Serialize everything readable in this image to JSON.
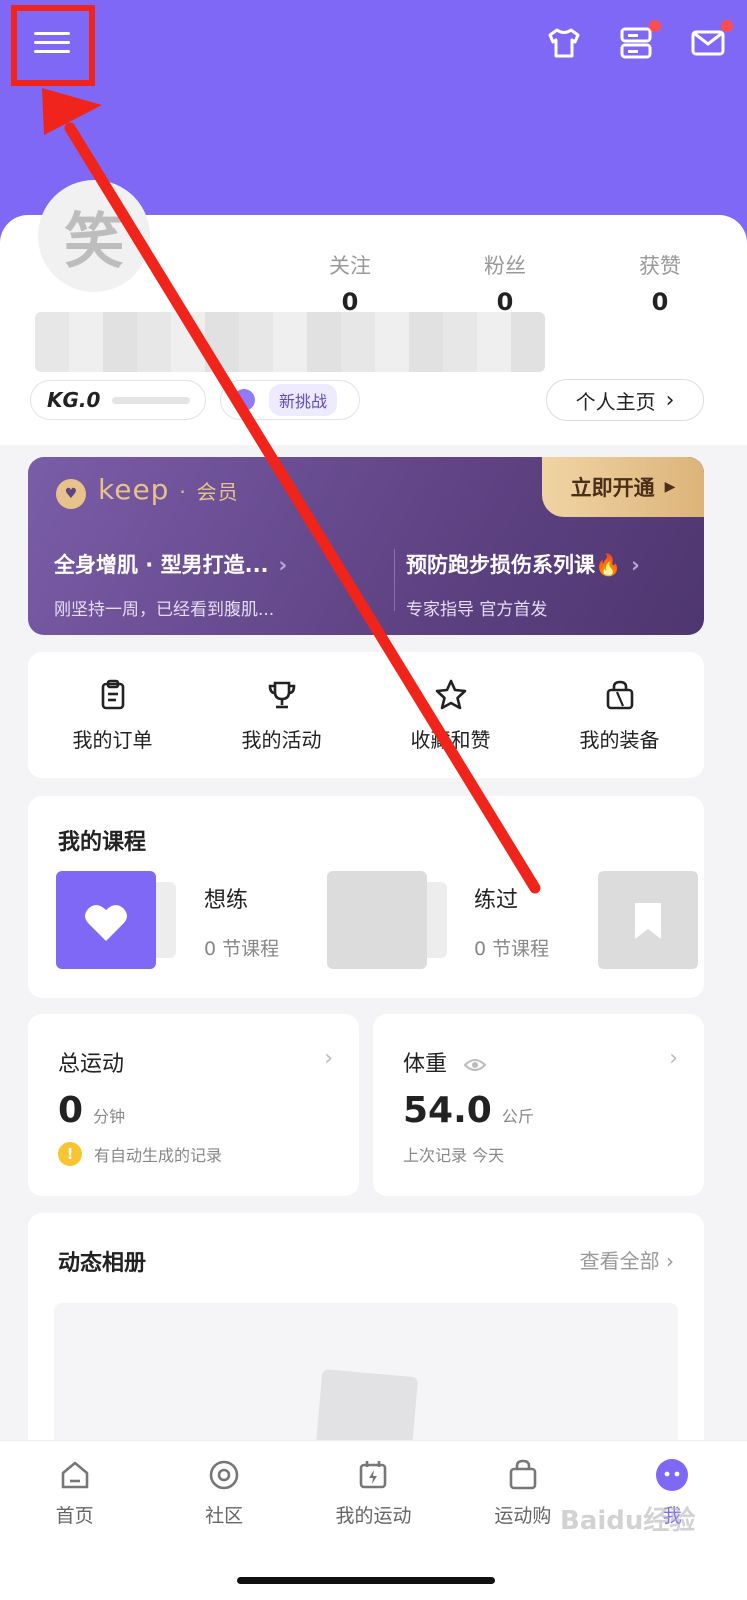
{
  "header": {
    "icons": [
      "menu-icon",
      "outfit-icon",
      "storage-icon",
      "mail-icon"
    ],
    "brand_color": "#7f68f5"
  },
  "profile": {
    "avatar_char": "笑",
    "stats": [
      {
        "label": "关注",
        "value": "0"
      },
      {
        "label": "粉丝",
        "value": "0"
      },
      {
        "label": "获赞",
        "value": "0"
      }
    ],
    "kg_level": "KG.0",
    "challenge_label": "新挑战",
    "homepage_label": "个人主页"
  },
  "vip": {
    "brand": "keep",
    "brand_sep": "·",
    "brand_sub": "会员",
    "open_label": "立即开通",
    "courses": [
      {
        "title": "全身增肌 · 型男打造...",
        "desc": "刚坚持一周，已经看到腹肌..."
      },
      {
        "title": "预防跑步损伤系列课🔥",
        "desc": "专家指导 官方首发"
      }
    ]
  },
  "quick_actions": [
    {
      "label": "我的订单",
      "icon": "clipboard-icon"
    },
    {
      "label": "我的活动",
      "icon": "trophy-icon"
    },
    {
      "label": "收藏和赞",
      "icon": "star-icon"
    },
    {
      "label": "我的装备",
      "icon": "bag-icon"
    }
  ],
  "courses": {
    "title": "我的课程",
    "items": [
      {
        "name": "想练",
        "count": "0 节课程"
      },
      {
        "name": "练过",
        "count": "0 节课程"
      }
    ]
  },
  "exercise": {
    "title": "总运动",
    "value": "0",
    "unit": "分钟",
    "note": "有自动生成的记录"
  },
  "weight": {
    "title": "体重",
    "value": "54.0",
    "unit": "公斤",
    "note": "上次记录 今天"
  },
  "album": {
    "title": "动态相册",
    "more_label": "查看全部"
  },
  "tabs": [
    {
      "label": "首页",
      "icon": "home-icon"
    },
    {
      "label": "社区",
      "icon": "community-icon"
    },
    {
      "label": "我的运动",
      "icon": "calendar-bolt-icon"
    },
    {
      "label": "运动购",
      "icon": "shopping-bag-icon"
    },
    {
      "label": "我",
      "icon": "me-icon",
      "active": true
    }
  ],
  "watermark": "Baidu经验"
}
